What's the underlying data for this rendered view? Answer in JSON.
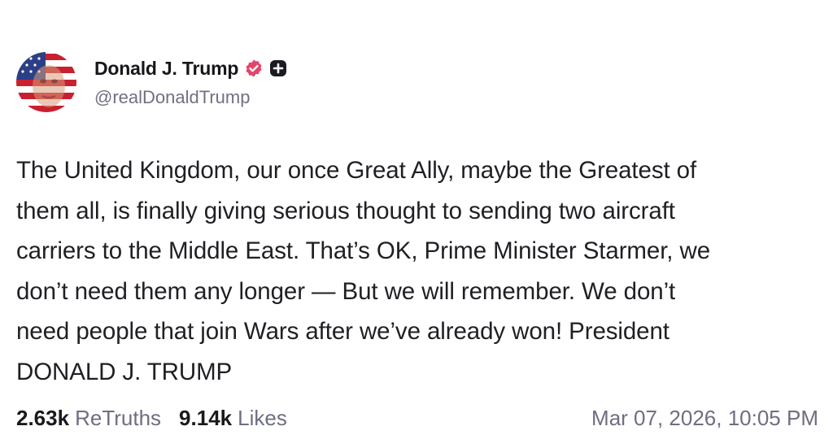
{
  "author": {
    "display_name": "Donald J. Trump",
    "handle": "@realDonaldTrump",
    "verified_color": "#e2466b",
    "avatar_icon": "flag-portrait-avatar"
  },
  "post": {
    "text": "The United Kingdom, our once Great Ally, maybe the Greatest of\nthem all, is finally giving serious thought to sending two aircraft\ncarriers to the Middle East. That’s OK, Prime Minister Starmer, we\ndon’t need them any longer — But we will remember. We don’t\nneed people that join Wars after we’ve already won! President\nDONALD J. TRUMP"
  },
  "stats": {
    "retruths_count": "2.63k",
    "retruths_label": "ReTruths",
    "likes_count": "9.14k",
    "likes_label": "Likes"
  },
  "timestamp": "Mar 07, 2026, 10:05 PM"
}
